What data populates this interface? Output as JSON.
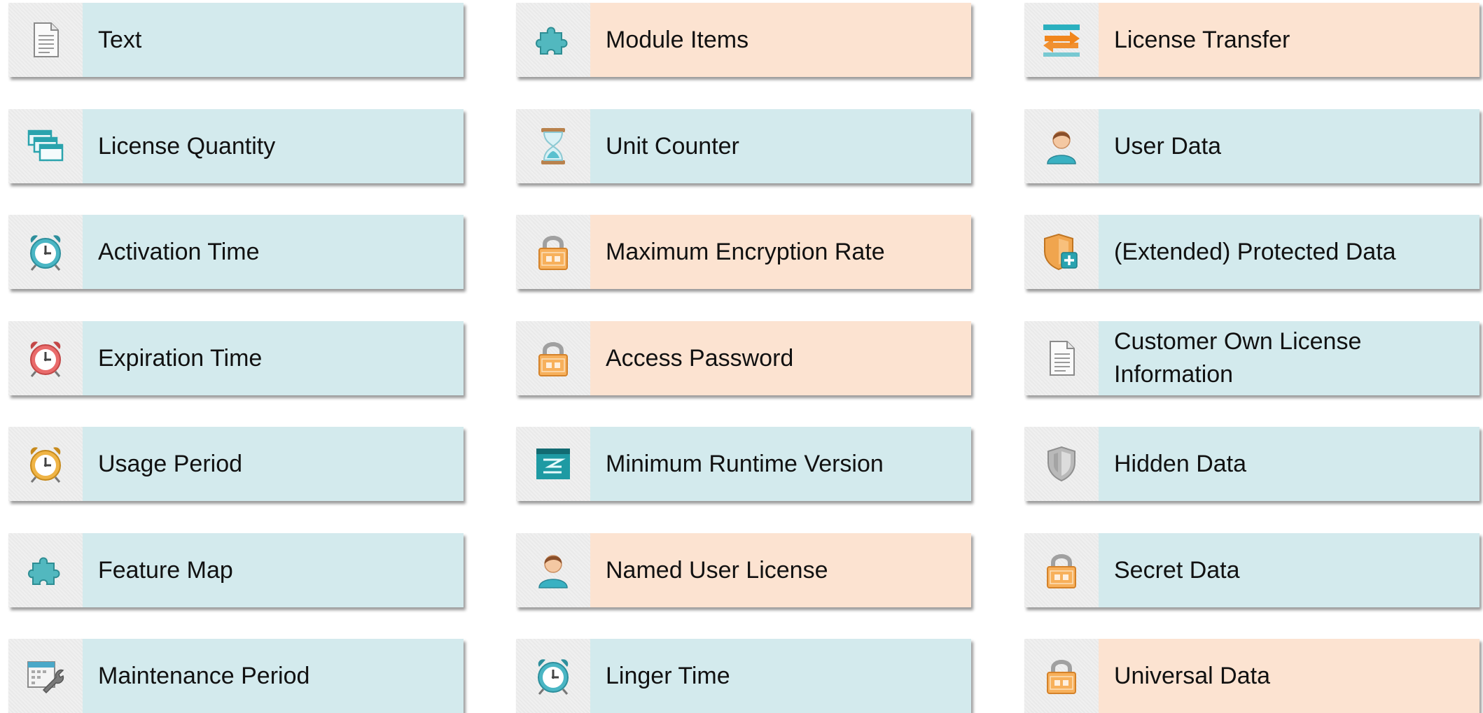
{
  "colors": {
    "blue": "#d3eaed",
    "peach": "#fce3d1"
  },
  "columns": [
    {
      "items": [
        {
          "label": "Text",
          "icon": "document-icon",
          "color": "blue"
        },
        {
          "label": "License Quantity",
          "icon": "stacked-windows-icon",
          "color": "blue"
        },
        {
          "label": "Activation Time",
          "icon": "alarm-clock-teal-icon",
          "color": "blue"
        },
        {
          "label": "Expiration Time",
          "icon": "alarm-clock-red-icon",
          "color": "blue"
        },
        {
          "label": "Usage Period",
          "icon": "alarm-clock-orange-icon",
          "color": "blue"
        },
        {
          "label": "Feature Map",
          "icon": "puzzle-piece-icon",
          "color": "blue"
        },
        {
          "label": "Maintenance Period",
          "icon": "calendar-wrench-icon",
          "color": "blue"
        }
      ]
    },
    {
      "items": [
        {
          "label": "Module Items",
          "icon": "puzzle-piece-icon",
          "color": "peach"
        },
        {
          "label": "Unit Counter",
          "icon": "hourglass-icon",
          "color": "blue"
        },
        {
          "label": "Maximum Encryption Rate",
          "icon": "padlock-icon",
          "color": "peach"
        },
        {
          "label": "Access Password",
          "icon": "padlock-icon",
          "color": "peach"
        },
        {
          "label": "Minimum Runtime Version",
          "icon": "runtime-version-icon",
          "color": "blue"
        },
        {
          "label": "Named User License",
          "icon": "user-icon",
          "color": "peach"
        },
        {
          "label": "Linger Time",
          "icon": "alarm-clock-teal-icon",
          "color": "blue"
        }
      ]
    },
    {
      "items": [
        {
          "label": "License Transfer",
          "icon": "transfer-arrows-icon",
          "color": "peach"
        },
        {
          "label": "User Data",
          "icon": "user-icon",
          "color": "blue"
        },
        {
          "label": "(Extended) Protected Data",
          "icon": "shield-plus-icon",
          "color": "blue"
        },
        {
          "label": "Customer Own License Information",
          "icon": "document-icon",
          "color": "blue"
        },
        {
          "label": "Hidden Data",
          "icon": "shield-gray-icon",
          "color": "blue"
        },
        {
          "label": "Secret Data",
          "icon": "padlock-icon",
          "color": "blue"
        },
        {
          "label": "Universal Data",
          "icon": "padlock-icon",
          "color": "peach"
        }
      ]
    }
  ]
}
